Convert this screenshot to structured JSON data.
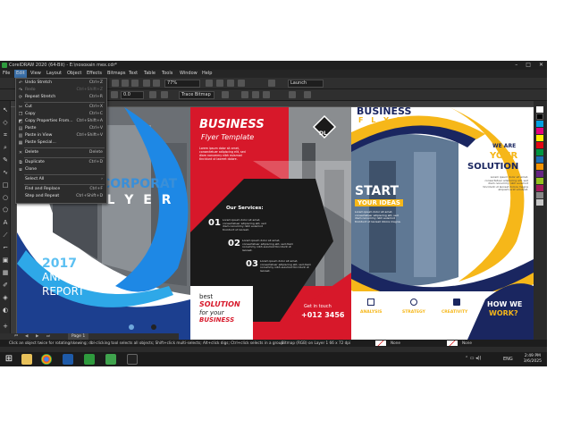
{
  "window": {
    "title": "CorelDRAW 2020 (64-Bit) - E:\\nosoxain mex.cdr*",
    "minimize": "–",
    "maximize": "□",
    "close": "✕"
  },
  "menubar": [
    "File",
    "Edit",
    "View",
    "Layout",
    "Object",
    "Effects",
    "Bitmaps",
    "Text",
    "Table",
    "Tools",
    "Window",
    "Help"
  ],
  "toolbar": {
    "zoom": "77%",
    "launch": "Launch",
    "angle": "0.0",
    "trace_bitmap": "Trace Bitmap"
  },
  "edit_menu": {
    "items": [
      {
        "label": "Undo Stretch",
        "shortcut": "Ctrl+Z",
        "icon": "undo-icon",
        "enabled": true
      },
      {
        "label": "Redo",
        "shortcut": "Ctrl+Shift+Z",
        "icon": "redo-icon",
        "enabled": false
      },
      {
        "label": "Repeat Stretch",
        "shortcut": "Ctrl+R",
        "icon": "repeat-icon",
        "enabled": true
      },
      {
        "label": "Cut",
        "shortcut": "Ctrl+X",
        "icon": "scissors-icon",
        "enabled": true
      },
      {
        "label": "Copy",
        "shortcut": "Ctrl+C",
        "icon": "copy-icon",
        "enabled": true
      },
      {
        "label": "Copy Properties From...",
        "shortcut": "Ctrl+Shift+A",
        "icon": "copy-properties-icon",
        "enabled": true
      },
      {
        "label": "Paste",
        "shortcut": "Ctrl+V",
        "icon": "paste-icon",
        "enabled": true
      },
      {
        "label": "Paste in View",
        "shortcut": "Ctrl+Shift+V",
        "icon": "paste-in-view-icon",
        "enabled": true
      },
      {
        "label": "Paste Special...",
        "shortcut": "",
        "icon": "paste-special-icon",
        "enabled": true
      },
      {
        "label": "Delete",
        "shortcut": "Delete",
        "icon": "delete-icon",
        "enabled": true
      },
      {
        "label": "Duplicate",
        "shortcut": "Ctrl+D",
        "icon": "duplicate-icon",
        "enabled": true
      },
      {
        "label": "Clone",
        "shortcut": "",
        "icon": "clone-icon",
        "enabled": true
      },
      {
        "label": "Select All",
        "shortcut": "›",
        "icon": "",
        "enabled": true
      },
      {
        "label": "Find and Replace",
        "shortcut": "Ctrl+F",
        "icon": "",
        "enabled": true
      },
      {
        "label": "Step and Repeat",
        "shortcut": "Ctrl+Shift+D",
        "icon": "",
        "enabled": true
      }
    ]
  },
  "artwork": {
    "panel1": {
      "heading_part": "CORPORAT",
      "flyer_word": "F L Y E R",
      "year": "2017",
      "line1": "ANNUAL",
      "line2": "REPORT"
    },
    "panel2": {
      "title": "BUSINESS",
      "subtitle": "Flyer Template",
      "logo": "DL",
      "lorem": "Lorem ipsum dolor sit amet, consectetuer adipiscing elit, sed diam nonummy nibh euismod tincidunt ut laoreet dolore.",
      "services_heading": "Our Services:",
      "services": [
        {
          "num": "01",
          "text": "Lorem ipsum dolor sit amet, consectetuer adipiscing elit, sed diam nonummy nibh euismod tincidunt ut laoreet."
        },
        {
          "num": "02",
          "text": "Lorem ipsum dolor sit amet, consectetuer adipiscing elit, sed diam nonummy nibh euismod tincidunt ut laoreet."
        },
        {
          "num": "03",
          "text": "Lorem ipsum dolor sit amet, consectetuer adipiscing elit, sed diam nonummy nibh euismod tincidunt ut laoreet."
        }
      ],
      "best": "best",
      "solution": "SOLUTION",
      "for_your": "for your",
      "business": "BUSINESS",
      "get_in_touch": "Get in touch",
      "phone": "+012 3456"
    },
    "panel3": {
      "title": "BUSINESS",
      "flyer": "F L Y E R",
      "we_are": "WE ARE",
      "your": "YOUR",
      "solution": "SOLUTION",
      "lorem": "Lorem ipsum dolor sit amet, consectetuer adipiscing elit, sed diam nonummy nibh euismod tincidunt ut laoreet dolore magna aliquam erat volutpat.",
      "start": "START",
      "your_ideas": "YOUR IDEAS",
      "lorem2": "Lorem ipsum dolor sit amet, consectetuer adipiscing elit, sed diam nonummy nibh euismod tincidunt ut laoreet dolore magna.",
      "features": [
        "ANALYSIS",
        "STRATEGY",
        "CREATIVITY"
      ],
      "how_we": "HOW WE",
      "work": "WORK?"
    }
  },
  "page_tab": "Page 1",
  "status": {
    "hint": "Click an object twice for rotating/skewing; dbl-clicking tool selects all objects; Shift+click multi-selects; Alt+click digs; Ctrl+click selects in a group",
    "object_info": "Bitmap (RGB) on Layer 1 66 x 72 dpi",
    "fill": "None",
    "outline": "None"
  },
  "taskbar": {
    "lang": "ENG",
    "time": "2:49 PM",
    "date": "3/6/2025"
  },
  "colors": {
    "accent_blue": "#1c5bb8",
    "accent_red": "#d7182a",
    "accent_yellow": "#f6b719",
    "navy": "#1a2660"
  }
}
